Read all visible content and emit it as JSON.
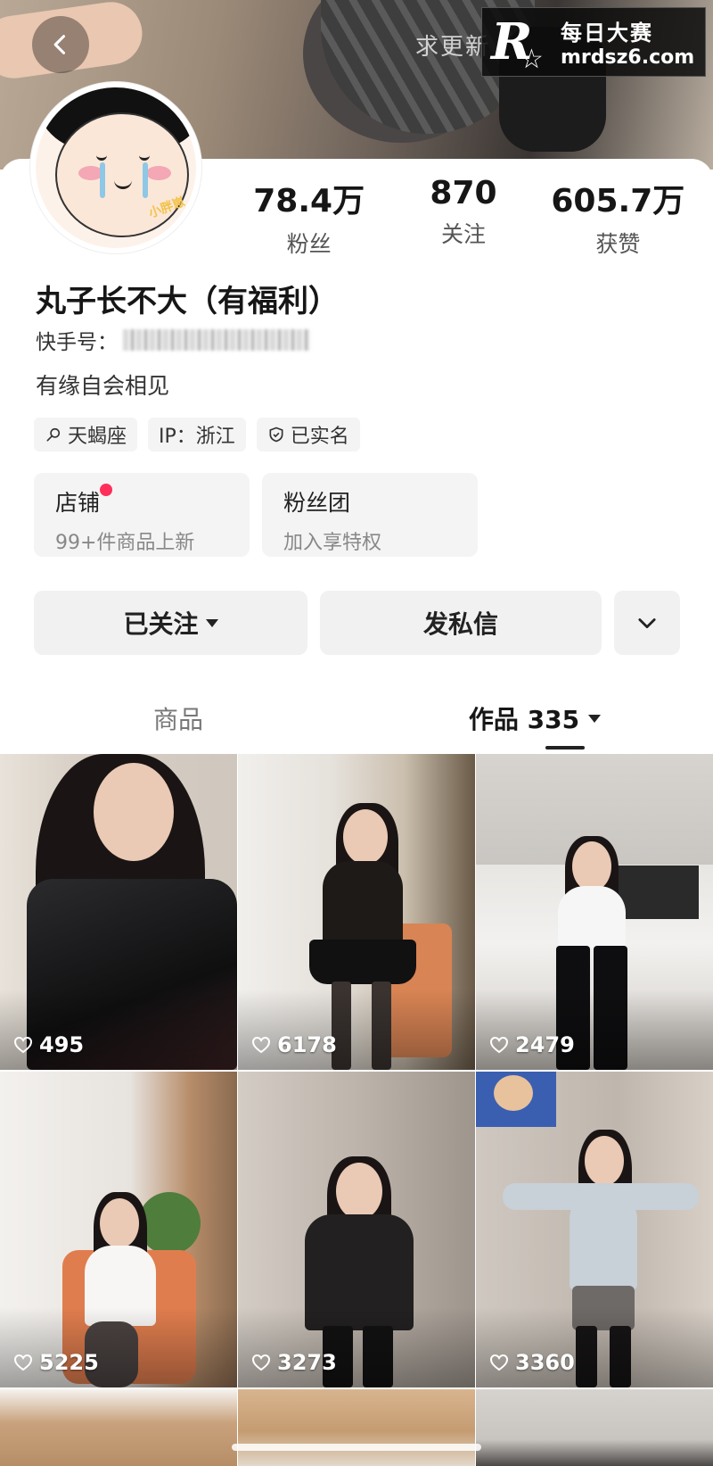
{
  "header": {
    "cover_text": "求更新",
    "watermark_cn": "每日大赛",
    "watermark_url": "mrdsz6.com",
    "watermark_logo": "R"
  },
  "profile": {
    "avatar_tag": "小胖崽",
    "stats": [
      {
        "value": "78.4万",
        "label": "粉丝"
      },
      {
        "value": "870",
        "label": "关注"
      },
      {
        "value": "605.7万",
        "label": "获赞"
      }
    ],
    "name": "丸子长不大（有福利）",
    "kid_label": "快手号：",
    "bio": "有缘自会相见",
    "tags": [
      {
        "icon": "search-icon",
        "label": "天蝎座"
      },
      {
        "icon": "",
        "label": "IP：浙江"
      },
      {
        "icon": "verified-shield-icon",
        "label": "已实名"
      }
    ],
    "mini_cards": [
      {
        "title": "店铺",
        "subtitle": "99+件商品上新",
        "has_dot": true
      },
      {
        "title": "粉丝团",
        "subtitle": "加入享特权",
        "has_dot": false
      }
    ],
    "actions": {
      "follow_label": "已关注",
      "message_label": "发私信"
    }
  },
  "tabs": [
    {
      "label": "商品",
      "active": false
    },
    {
      "label": "作品 335",
      "active": true
    }
  ],
  "videos": [
    {
      "likes": "495"
    },
    {
      "likes": "6178"
    },
    {
      "likes": "2479"
    },
    {
      "likes": "5225"
    },
    {
      "likes": "3273"
    },
    {
      "likes": "3360"
    }
  ],
  "colors": {
    "accent_dot": "#ff2e5a",
    "button_bg": "#f1f1f1"
  }
}
